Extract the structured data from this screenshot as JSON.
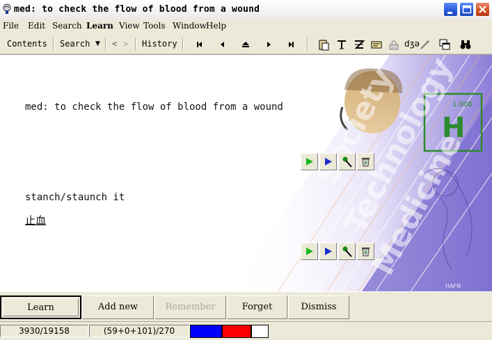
{
  "window": {
    "title": "med: to check the flow of blood from a wound",
    "app_icon": "supermemo-brain-icon",
    "controls": [
      "minimize-icon",
      "maximize-icon",
      "close-icon"
    ]
  },
  "menu": {
    "items": [
      "File",
      "Edit",
      "Search",
      "Learn",
      "View",
      "Tools",
      "Window",
      "Help"
    ],
    "active": "Learn"
  },
  "toolbar": {
    "contents_label": "Contents",
    "search_label": "Search",
    "back_glyph": "<",
    "forward_glyph": ">",
    "history_label": "History",
    "nav_icons": [
      "first-icon",
      "previous-icon",
      "parent-icon",
      "next-icon",
      "last-icon"
    ],
    "tool_icons": [
      "paste-icon",
      "text-icon",
      "formula-icon",
      "edit-icon",
      "lock-icon",
      "phonetics-icon",
      "magic-wand-icon",
      "windows-icon",
      "binoculars-icon"
    ],
    "phonetics_label": "dʒə"
  },
  "card": {
    "question": "med: to check the flow of blood from a wound",
    "answer_line1": "stanch/staunch it",
    "answer_line2": "止血",
    "component_controls": [
      "play-green-icon",
      "play-blue-icon",
      "microphone-icon",
      "recycle-bin-icon"
    ]
  },
  "bottom_buttons": {
    "learn": "Learn",
    "add_new": "Add new",
    "remember": "Remember",
    "forget": "Forget",
    "dismiss": "Dismiss"
  },
  "status": {
    "counts": "3930/19158",
    "queue": "(59+0+101)/270",
    "colors": [
      "#0000FF",
      "#FF0000",
      "#FFFFFF"
    ]
  }
}
